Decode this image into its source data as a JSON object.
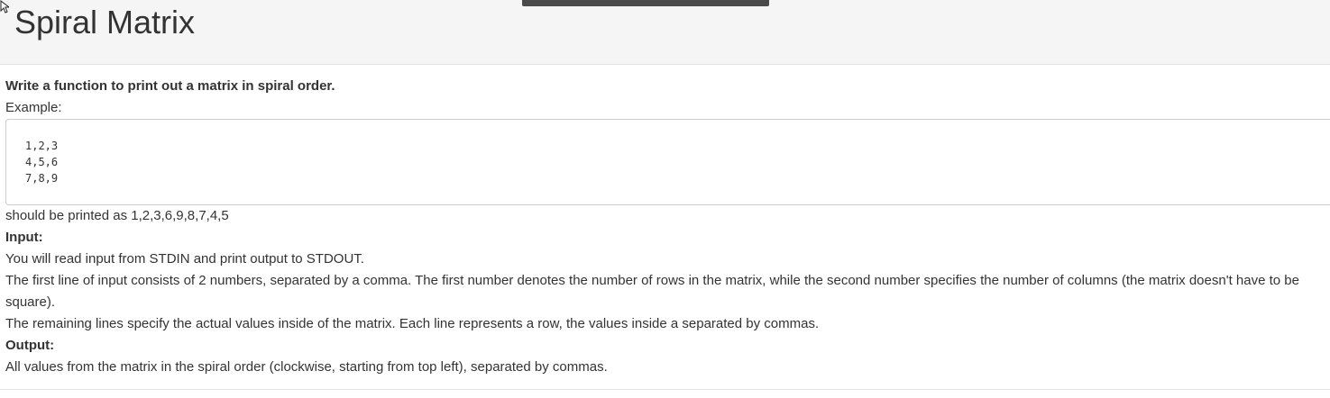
{
  "header": {
    "title": "Spiral Matrix"
  },
  "problem": {
    "intro": "Write a function to print out a matrix in spiral order.",
    "example_label": "Example:",
    "example_matrix": [
      "1,2,3",
      "4,5,6",
      "7,8,9"
    ],
    "example_result": "should be printed as 1,2,3,6,9,8,7,4,5",
    "input_heading": "Input:",
    "input_lines": [
      "You will read input from STDIN and print output to STDOUT.",
      "The first line of input consists of 2 numbers, separated by a comma. The first number denotes the number of rows in the matrix, while the second number specifies the number of columns (the matrix doesn't have to be square).",
      "The remaining lines specify the actual values inside of the matrix. Each line represents a row, the values inside a separated by commas."
    ],
    "output_heading": "Output:",
    "output_line": "All values from the matrix in the spiral order (clockwise, starting from top left), separated by commas."
  }
}
